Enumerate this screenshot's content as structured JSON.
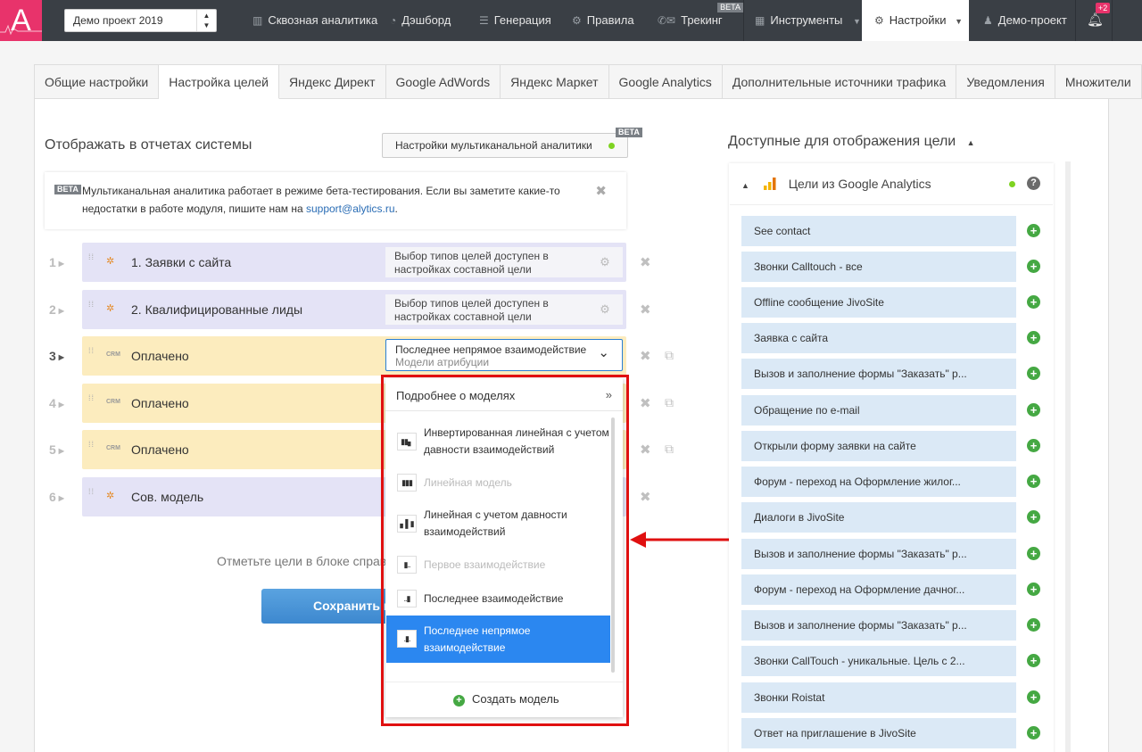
{
  "app": {
    "logo_letter": "A",
    "project": "Демо проект 2019"
  },
  "topnav": {
    "items": [
      {
        "label": "Сквозная аналитика",
        "icon": "bar-chart-icon"
      },
      {
        "label": "Дэшборд",
        "icon": "gauge-icon"
      },
      {
        "label": "Генерация",
        "icon": "list-icon"
      },
      {
        "label": "Правила",
        "icon": "gears-icon"
      },
      {
        "label": "Трекинг",
        "icon": "phone-mail-icon",
        "badge": "BETA"
      },
      {
        "label": "Инструменты",
        "icon": "grid-icon"
      },
      {
        "label": "Настройки",
        "icon": "gear-icon"
      },
      {
        "label": "Демо-проект",
        "icon": "user-icon"
      }
    ],
    "notification_count": "+2"
  },
  "tabs": [
    "Общие настройки",
    "Настройка целей",
    "Яндекс Директ",
    "Google AdWords",
    "Яндекс Маркет",
    "Google Analytics",
    "Дополнительные источники трафика",
    "Уведомления",
    "Множители"
  ],
  "active_tab": "Настройка целей",
  "left": {
    "title": "Отображать в отчетах системы",
    "multichannel_button": "Настройки мультиканальной аналитики",
    "beta_label": "BETA",
    "notice_text": "Мультиканальная аналитика работает в режиме бета-тестирования. Если вы заметите какие-то недостатки в работе модуля, пишите нам на",
    "notice_email": "support@alytics.ru",
    "notice_dot": ".",
    "goals": [
      {
        "num": "1",
        "name": "1. Заявки с сайта",
        "hint": "Выбор типов целей доступен в настройках составной цели"
      },
      {
        "num": "2",
        "name": "2. Квалифицированные лиды",
        "hint": "Выбор типов целей доступен в настройках составной цели"
      },
      {
        "num": "3",
        "name": "Оплачено",
        "crm": "CRM"
      },
      {
        "num": "4",
        "name": "Оплачено",
        "crm": "CRM"
      },
      {
        "num": "5",
        "name": "Оплачено",
        "crm": "CRM"
      },
      {
        "num": "6",
        "name": "Сов. модель"
      }
    ],
    "attribution_select": {
      "value": "Последнее непрямое взаимодействие",
      "sub": "Модели атрибуции"
    },
    "bottom_hint": "Отметьте цели в блоке справ",
    "save_button": "Сохранить и"
  },
  "dropdown": {
    "header": "Подробнее о моделях",
    "more": "»",
    "items": [
      {
        "label": "Инвертированная линейная с учетом давности взаимодействий",
        "state": "normal",
        "icon": "inverted-linear-icon"
      },
      {
        "label": "Линейная модель",
        "state": "disabled",
        "icon": "linear-icon"
      },
      {
        "label": "Линейная с учетом давности взаимодействий",
        "state": "normal",
        "icon": "time-decay-icon"
      },
      {
        "label": "Первое взаимодействие",
        "state": "disabled",
        "icon": "first-touch-icon"
      },
      {
        "label": "Последнее взаимодействие",
        "state": "normal",
        "icon": "last-touch-icon"
      },
      {
        "label": "Последнее непрямое взаимодействие",
        "state": "selected",
        "icon": "last-indirect-icon"
      }
    ],
    "create": "Создать модель"
  },
  "right": {
    "title": "Доступные для отображения цели",
    "source": "Цели из Google Analytics",
    "goals": [
      "See contact",
      "Звонки Calltouch - все",
      "Offline сообщение JivoSite",
      "Заявка с сайта",
      "Вызов и заполнение формы \"Заказать\" р...",
      "Обращение по e-mail",
      "Открыли форму заявки на сайте",
      "Форум - переход на Оформление жилог...",
      "Диалоги в JivoSite",
      "Вызов и заполнение формы \"Заказать\" р...",
      "Форум - переход на Оформление дачног...",
      "Вызов и заполнение формы \"Заказать\" р...",
      "Звонки CallTouch - уникальные. Цель с 2...",
      "Звонки Roistat",
      "Ответ на приглашение в JivoSite"
    ]
  },
  "colors": {
    "accent": "#e8336b",
    "nav_bg": "#3a3f45",
    "selected_blue": "#2b87f0",
    "annotation_red": "#e01010",
    "add_green": "#45a843"
  }
}
